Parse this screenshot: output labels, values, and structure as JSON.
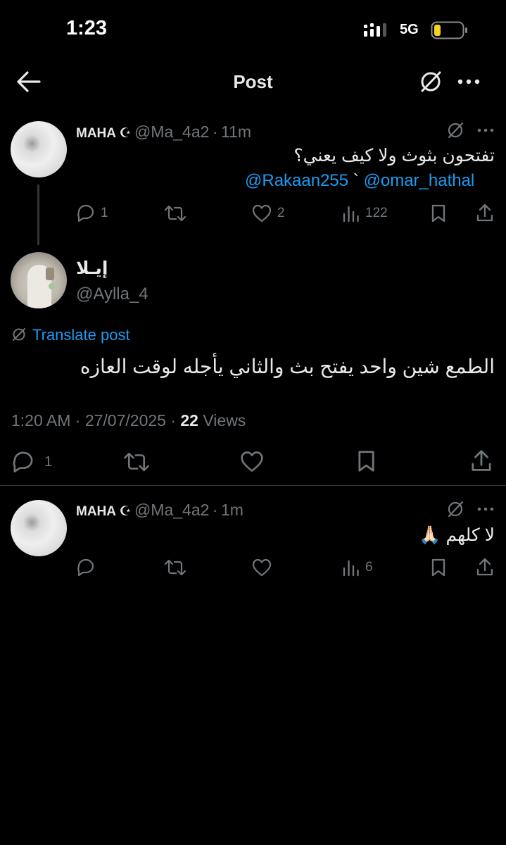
{
  "status_bar": {
    "time": "1:23",
    "network": "5G"
  },
  "header": {
    "title": "Post"
  },
  "reply1": {
    "name": "MAHA",
    "badge": "☪",
    "handle": "@Ma_4a2",
    "sep": "·",
    "time": "11m",
    "text": "تفتحون بثوث ولا كيف يعني؟",
    "mention1": "@Rakaan255",
    "mention_sep": "`",
    "mention2": "@omar_hathal",
    "replies": "1",
    "likes": "2",
    "views": "122"
  },
  "main_post": {
    "name": "إيـلا",
    "handle": "@Aylla_4",
    "translate": "Translate post",
    "text": "الطمع شين واحد يفتح بث والثاني يأجله لوقت العازه",
    "timestamp": "1:20 AM · 27/07/2025 ·",
    "views_count": "22",
    "views_label": "Views",
    "replies": "1"
  },
  "reply2": {
    "name": "MAHA",
    "badge": "☪",
    "handle": "@Ma_4a2",
    "sep": "·",
    "time": "1m",
    "text": "لا كلهم 🙏🏻",
    "views": "6"
  }
}
